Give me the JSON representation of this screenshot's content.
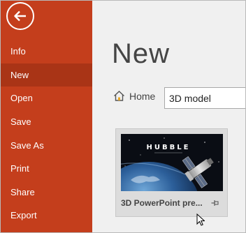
{
  "sidebar": {
    "back_icon": "back-arrow-icon",
    "items": [
      {
        "label": "Info"
      },
      {
        "label": "New",
        "active": true
      },
      {
        "label": "Open"
      },
      {
        "label": "Save"
      },
      {
        "label": "Save As"
      },
      {
        "label": "Print"
      },
      {
        "label": "Share"
      },
      {
        "label": "Export"
      }
    ]
  },
  "main": {
    "title": "New",
    "home_icon": "home-icon",
    "home_label": "Home",
    "search_value": "3D model",
    "template": {
      "thumbnail_text": "HUBBLE",
      "label": "3D PowerPoint pre...",
      "pin_icon": "pin-icon"
    }
  },
  "colors": {
    "sidebar_bg": "#c43e1c",
    "sidebar_active_bg": "#a93416",
    "main_bg": "#f0f0f0",
    "text": "#444444"
  }
}
